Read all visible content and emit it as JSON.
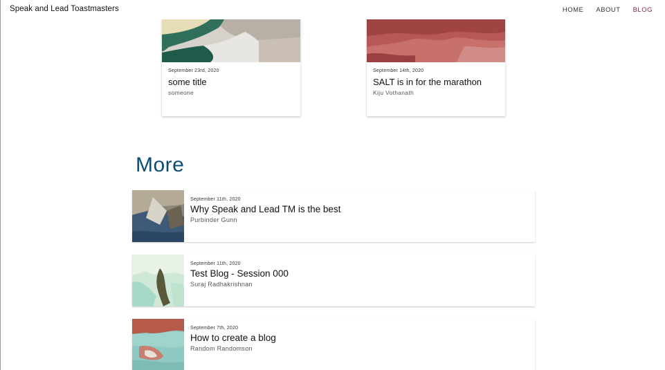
{
  "header": {
    "brand": "Speak and Lead Toastmasters",
    "nav": {
      "home": "HOME",
      "about": "ABOUT",
      "blog": "BLOG"
    }
  },
  "featured": [
    {
      "date": "September 23rd, 2020",
      "title": "some title",
      "author": "someone"
    },
    {
      "date": "September 14th, 2020",
      "title": "SALT is in for the marathon",
      "author": "Kiju Vothanath"
    }
  ],
  "more": {
    "heading": "More",
    "items": [
      {
        "date": "September 11th, 2020",
        "title": "Why Speak and Lead TM is the best",
        "author": "Purbinder Gunn"
      },
      {
        "date": "September 11th, 2020",
        "title": "Test Blog - Session 000",
        "author": "Suraj Radhakrishnan"
      },
      {
        "date": "September 7th, 2020",
        "title": "How to create a blog",
        "author": "Random Randomson"
      }
    ]
  },
  "colors": {
    "heading": "#0e4d73",
    "active_nav": "#7b2a3a"
  }
}
